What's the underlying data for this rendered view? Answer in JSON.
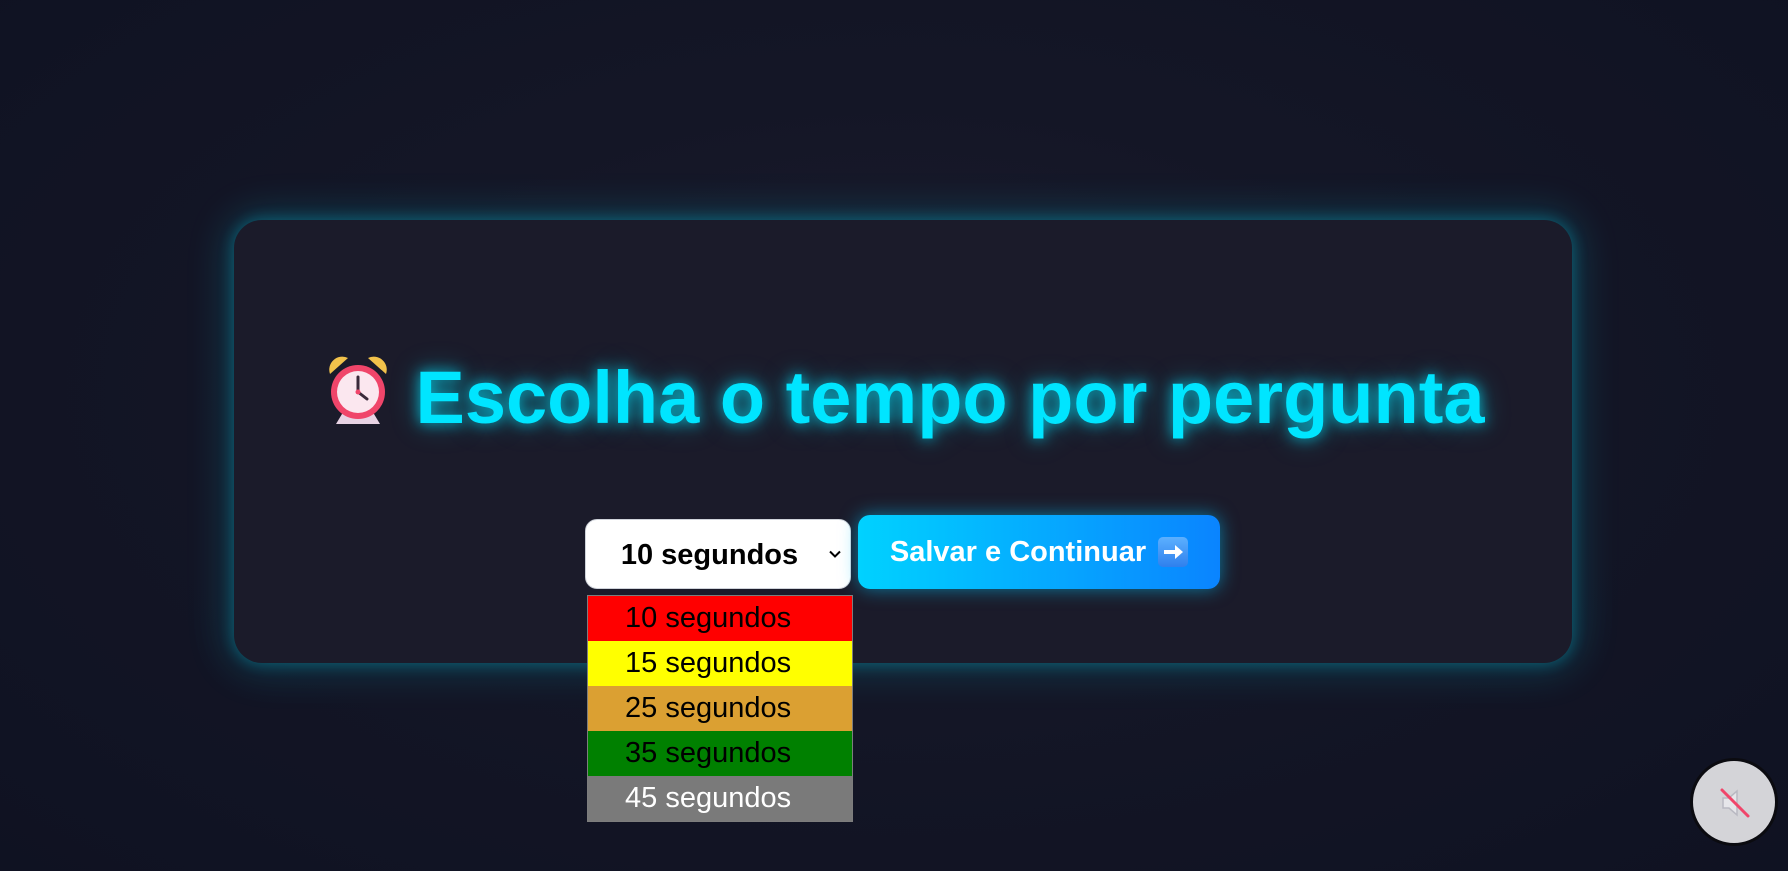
{
  "page": {
    "title": "Escolha o tempo por pergunta",
    "title_icon": "alarm-clock-icon",
    "accent_color": "#00e5ff",
    "background_color": "#141626"
  },
  "time_select": {
    "selected": "10 segundos",
    "options": [
      {
        "label": "10 segundos",
        "color": "#ff0000"
      },
      {
        "label": "15 segundos",
        "color": "#ffff00"
      },
      {
        "label": "25 segundos",
        "color": "#dba032"
      },
      {
        "label": "35 segundos",
        "color": "#008000"
      },
      {
        "label": "45 segundos",
        "color": "#7a7a7a"
      }
    ]
  },
  "save_button": {
    "label": "Salvar e Continuar",
    "icon": "right-arrow-icon",
    "gradient": [
      "#00d2ff",
      "#0a84ff"
    ]
  },
  "sound_toggle": {
    "icon": "speaker-muted-icon",
    "state": "muted"
  }
}
